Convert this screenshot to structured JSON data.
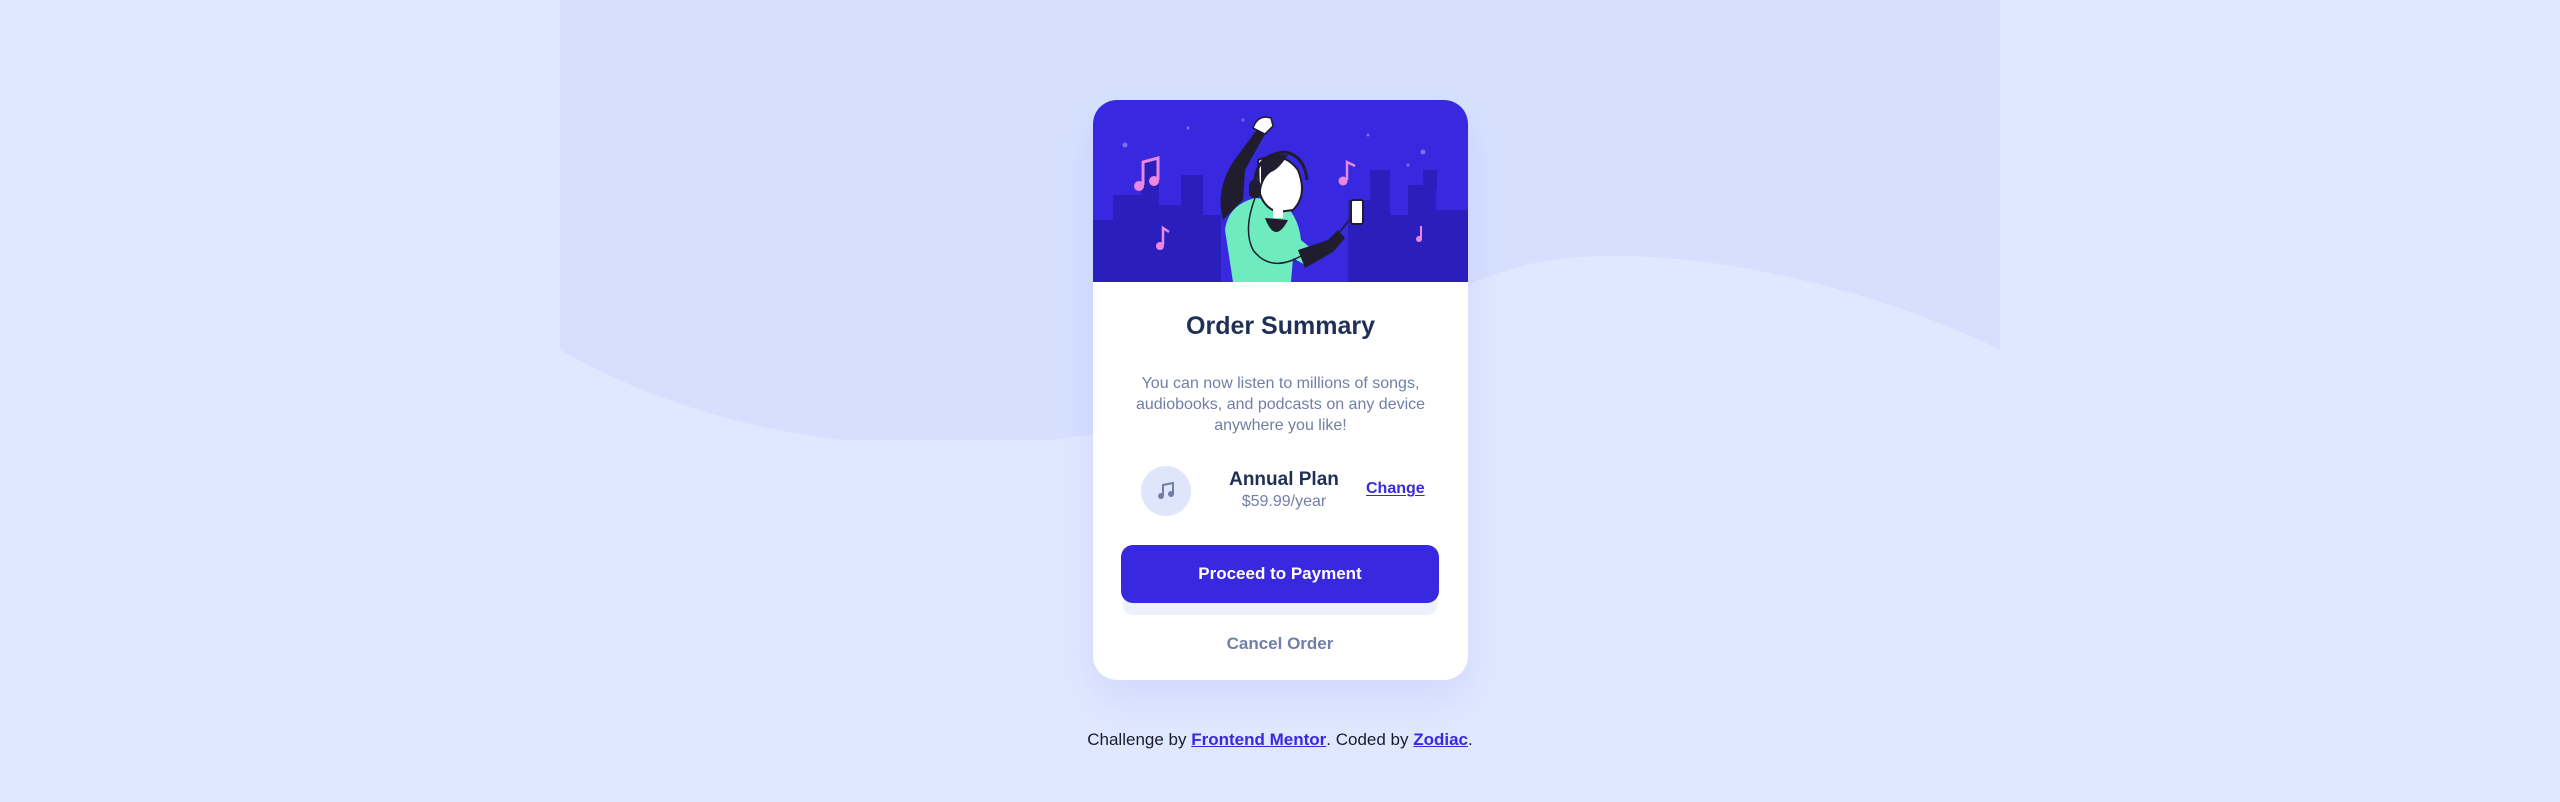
{
  "colors": {
    "background": "#e0e8ff",
    "pattern": "#d6e0fe",
    "primary": "#3829e0",
    "heading": "#1f2f56",
    "muted": "#717fa6",
    "hero_bg": "#3829e0",
    "accent_pink": "#ea88e1",
    "accent_green": "#6fecbf"
  },
  "card": {
    "title": "Order Summary",
    "description": "You can now listen to millions of songs, audiobooks, and podcasts on any device anywhere you like!",
    "plan": {
      "icon": "music-note-icon",
      "name": "Annual Plan",
      "price": "$59.99/year",
      "change_label": "Change"
    },
    "pay_label": "Proceed to Payment",
    "cancel_label": "Cancel Order",
    "hero_illustration": "dancing-person-with-headphones-illustration"
  },
  "footer": {
    "prefix": "Challenge by ",
    "challenge_link": "Frontend Mentor",
    "middle": ". Coded by ",
    "author_link": "Zodiac",
    "suffix": "."
  }
}
